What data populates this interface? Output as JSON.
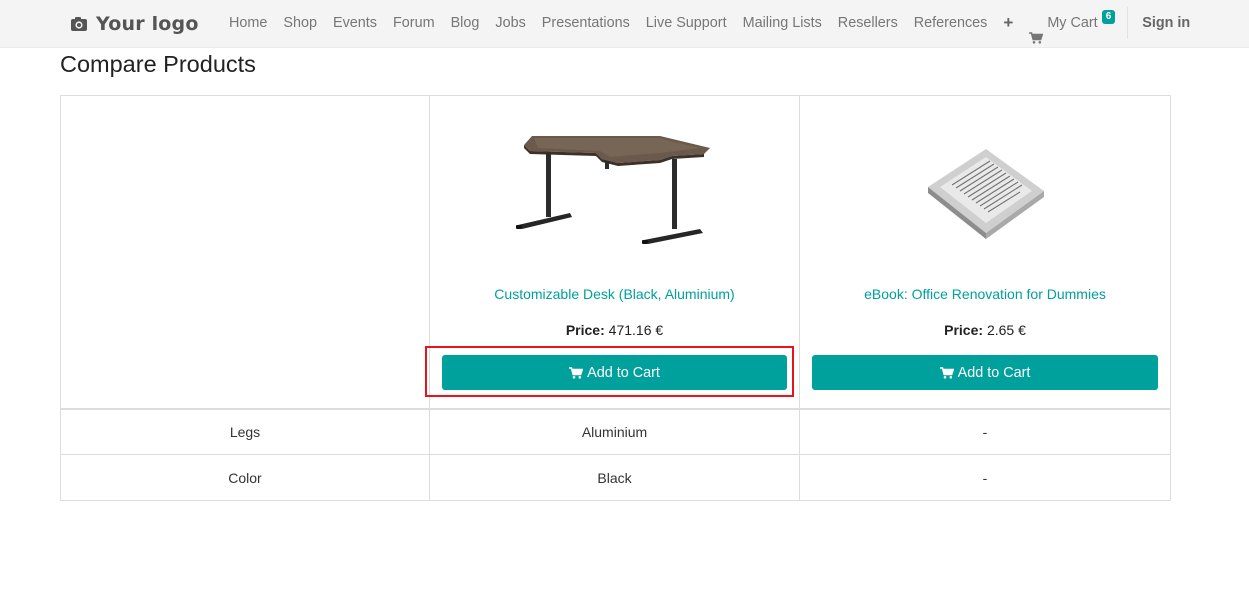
{
  "header": {
    "logo_text": "Your logo",
    "nav_items": [
      "Home",
      "Shop",
      "Events",
      "Forum",
      "Blog",
      "Jobs",
      "Presentations",
      "Live Support",
      "Mailing Lists",
      "Resellers",
      "References"
    ],
    "plus_label": "+",
    "cart_label": "My Cart",
    "cart_count": "6",
    "signin_label": "Sign in"
  },
  "page": {
    "title": "Compare Products"
  },
  "products": [
    {
      "name": "Customizable Desk (Black, Aluminium)",
      "price_label": "Price:",
      "price_value": "471.16 €",
      "add_to_cart_label": "Add to Cart",
      "image_icon": "desk-image",
      "highlighted": true
    },
    {
      "name": "eBook: Office Renovation for Dummies",
      "price_label": "Price:",
      "price_value": "2.65 €",
      "add_to_cart_label": "Add to Cart",
      "image_icon": "ebook-reader-image",
      "highlighted": false
    }
  ],
  "attributes": [
    {
      "name": "Legs",
      "values": [
        "Aluminium",
        "-"
      ]
    },
    {
      "name": "Color",
      "values": [
        "Black",
        "-"
      ]
    }
  ],
  "colors": {
    "accent": "#00a09d",
    "highlight": "#e8141a"
  }
}
